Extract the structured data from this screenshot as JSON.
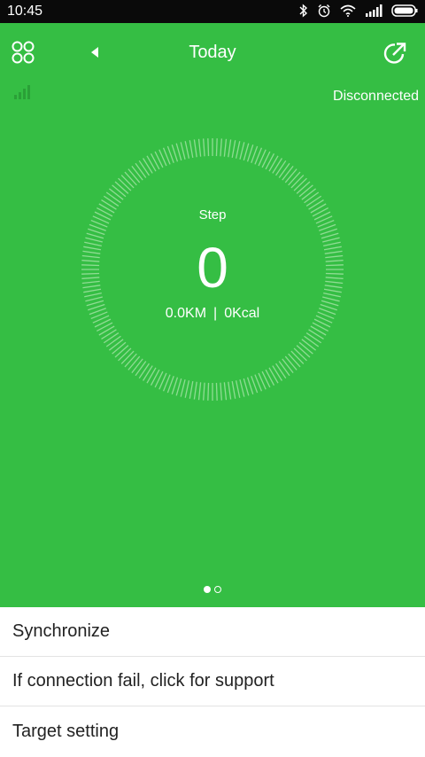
{
  "status_bar": {
    "time": "10:45",
    "icons": [
      "bluetooth-icon",
      "alarm-icon",
      "wifi-icon",
      "cell-signal-icon",
      "battery-icon"
    ]
  },
  "header": {
    "title": "Today",
    "left_icon": "apps-grid-icon",
    "back_icon": "back-arrow-icon",
    "share_icon": "share-icon"
  },
  "connection": {
    "signal_icon": "signal-strength-icon",
    "status": "Disconnected"
  },
  "steps": {
    "label": "Step",
    "count": "0",
    "distance": "0.0KM",
    "separator": "|",
    "calories": "0Kcal"
  },
  "pager": {
    "pages": 2,
    "active_index": 0
  },
  "menu": {
    "items": [
      {
        "label": "Synchronize"
      },
      {
        "label": "If connection fail, click for support"
      },
      {
        "label": "Target setting"
      }
    ]
  },
  "colors": {
    "primary_green": "#35be44",
    "status_bar": "#0a0a0a",
    "text_dark": "#222222",
    "divider": "#e3e3e3"
  }
}
